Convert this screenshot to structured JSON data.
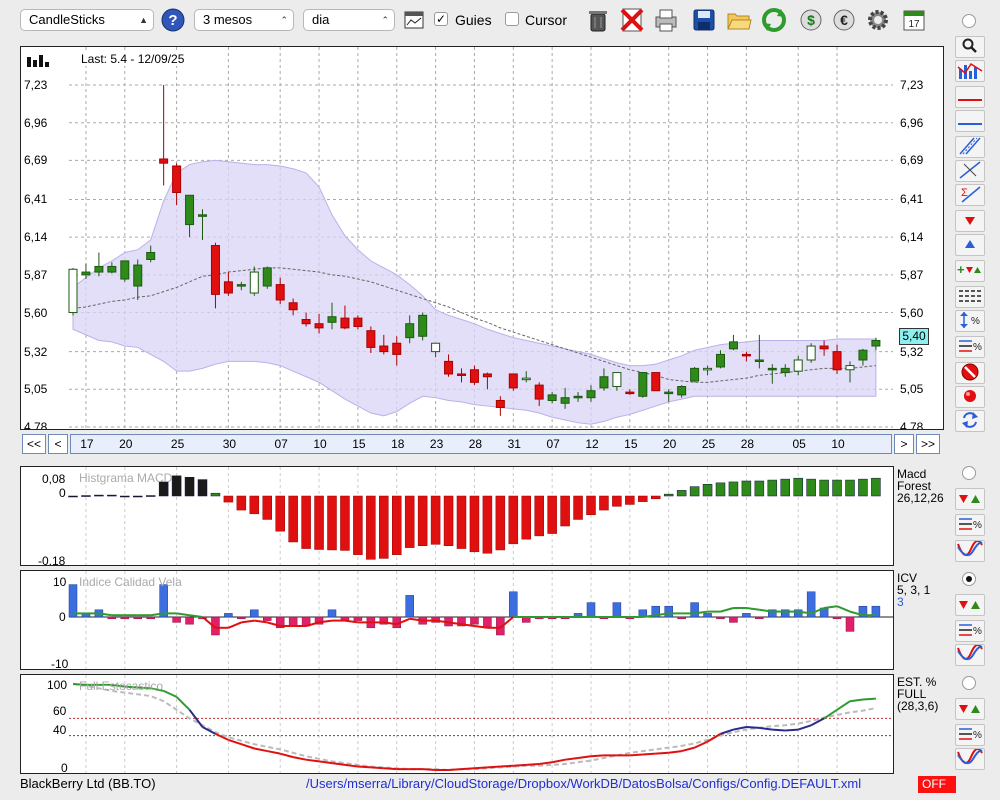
{
  "toolbar": {
    "chart_type": "CandleSticks",
    "period": "3 mesos",
    "interval": "dia",
    "guies_label": "Guies",
    "guies_checked": true,
    "cursor_label": "Cursor",
    "cursor_checked": false
  },
  "main_chart": {
    "last_label": "Last: 5.4 - 12/09/25",
    "price_tag": "5,40"
  },
  "nav": {
    "first": "<<",
    "prev": "<",
    "next": ">",
    "last": ">>"
  },
  "panels": {
    "macd": {
      "title": "Histgrama MACD",
      "name1": "Macd",
      "name2": "Forest",
      "params": "26,12,26",
      "y_labels": [
        "0,08",
        "0",
        "-0,18"
      ]
    },
    "icv": {
      "title": "Indice Calidad Vela",
      "name1": "ICV",
      "params": "5, 3, 1",
      "extra": "3",
      "y_labels": [
        "10",
        "0",
        "-10"
      ]
    },
    "est": {
      "title": "Full Estocastico",
      "name1": "EST. %",
      "name2": "FULL",
      "params": "(28,3,6)",
      "y_labels": [
        "100",
        "60",
        "40",
        "0"
      ]
    }
  },
  "status": {
    "company": "BlackBerry Ltd (BB.TO)",
    "path": "/Users/mserra/Library/CloudStorage/Dropbox/WorkDB/DatosBolsa/Configs/Config.DEFAULT.xml",
    "off": "OFF"
  },
  "colors": {
    "up": "#2e8b1a",
    "down": "#e01010",
    "band": "#d9d4f5",
    "ma": "#666666",
    "blue": "#2b5fd9"
  },
  "chart_data": [
    {
      "type": "candlestick",
      "title": "",
      "y_ticks": [
        7.23,
        6.96,
        6.69,
        6.41,
        6.14,
        5.87,
        5.6,
        5.32,
        5.05,
        4.78
      ],
      "ylim": [
        4.78,
        7.23
      ],
      "x_tick_labels": [
        "17",
        "20",
        "25",
        "30",
        "07",
        "10",
        "15",
        "18",
        "23",
        "28",
        "31",
        "07",
        "12",
        "15",
        "20",
        "25",
        "28",
        "05",
        "10"
      ],
      "grid": true,
      "candles": [
        {
          "o": 5.6,
          "h": 5.92,
          "l": 5.58,
          "c": 5.91
        },
        {
          "o": 5.87,
          "h": 5.95,
          "l": 5.84,
          "c": 5.89
        },
        {
          "o": 5.89,
          "h": 6.03,
          "l": 5.86,
          "c": 5.93
        },
        {
          "o": 5.89,
          "h": 5.96,
          "l": 5.88,
          "c": 5.93
        },
        {
          "o": 5.84,
          "h": 5.97,
          "l": 5.82,
          "c": 5.97
        },
        {
          "o": 5.79,
          "h": 5.98,
          "l": 5.69,
          "c": 5.94
        },
        {
          "o": 5.98,
          "h": 6.08,
          "l": 5.96,
          "c": 6.03
        },
        {
          "o": 6.7,
          "h": 7.23,
          "l": 6.51,
          "c": 6.67
        },
        {
          "o": 6.65,
          "h": 6.67,
          "l": 6.37,
          "c": 6.46
        },
        {
          "o": 6.23,
          "h": 6.44,
          "l": 6.14,
          "c": 6.44
        },
        {
          "o": 6.3,
          "h": 6.34,
          "l": 6.12,
          "c": 6.3
        },
        {
          "o": 6.08,
          "h": 6.1,
          "l": 5.63,
          "c": 5.73
        },
        {
          "o": 5.82,
          "h": 5.89,
          "l": 5.72,
          "c": 5.74
        },
        {
          "o": 5.8,
          "h": 5.82,
          "l": 5.76,
          "c": 5.8
        },
        {
          "o": 5.74,
          "h": 5.93,
          "l": 5.72,
          "c": 5.89
        },
        {
          "o": 5.79,
          "h": 5.93,
          "l": 5.77,
          "c": 5.92
        },
        {
          "o": 5.8,
          "h": 5.85,
          "l": 5.66,
          "c": 5.69
        },
        {
          "o": 5.67,
          "h": 5.7,
          "l": 5.58,
          "c": 5.62
        },
        {
          "o": 5.55,
          "h": 5.6,
          "l": 5.5,
          "c": 5.52
        },
        {
          "o": 5.52,
          "h": 5.59,
          "l": 5.45,
          "c": 5.49
        },
        {
          "o": 5.53,
          "h": 5.67,
          "l": 5.48,
          "c": 5.57
        },
        {
          "o": 5.56,
          "h": 5.65,
          "l": 5.48,
          "c": 5.49
        },
        {
          "o": 5.56,
          "h": 5.58,
          "l": 5.48,
          "c": 5.5
        },
        {
          "o": 5.47,
          "h": 5.5,
          "l": 5.31,
          "c": 5.35
        },
        {
          "o": 5.36,
          "h": 5.44,
          "l": 5.3,
          "c": 5.32
        },
        {
          "o": 5.38,
          "h": 5.43,
          "l": 5.22,
          "c": 5.3
        },
        {
          "o": 5.42,
          "h": 5.58,
          "l": 5.38,
          "c": 5.52
        },
        {
          "o": 5.43,
          "h": 5.6,
          "l": 5.4,
          "c": 5.58
        },
        {
          "o": 5.32,
          "h": 5.38,
          "l": 5.28,
          "c": 5.38
        },
        {
          "o": 5.25,
          "h": 5.3,
          "l": 5.14,
          "c": 5.16
        },
        {
          "o": 5.16,
          "h": 5.2,
          "l": 5.1,
          "c": 5.15
        },
        {
          "o": 5.19,
          "h": 5.22,
          "l": 5.08,
          "c": 5.1
        },
        {
          "o": 5.16,
          "h": 5.17,
          "l": 5.05,
          "c": 5.14
        },
        {
          "o": 4.97,
          "h": 5.0,
          "l": 4.86,
          "c": 4.92
        },
        {
          "o": 5.16,
          "h": 5.16,
          "l": 5.04,
          "c": 5.06
        },
        {
          "o": 5.12,
          "h": 5.18,
          "l": 5.1,
          "c": 5.13
        },
        {
          "o": 5.08,
          "h": 5.1,
          "l": 4.93,
          "c": 4.98
        },
        {
          "o": 4.97,
          "h": 5.03,
          "l": 4.95,
          "c": 5.01
        },
        {
          "o": 4.95,
          "h": 5.06,
          "l": 4.91,
          "c": 4.99
        },
        {
          "o": 4.99,
          "h": 5.03,
          "l": 4.96,
          "c": 5.0
        },
        {
          "o": 4.99,
          "h": 5.08,
          "l": 4.96,
          "c": 5.04
        },
        {
          "o": 5.06,
          "h": 5.2,
          "l": 5.04,
          "c": 5.14
        },
        {
          "o": 5.07,
          "h": 5.17,
          "l": 5.04,
          "c": 5.17
        },
        {
          "o": 5.03,
          "h": 5.05,
          "l": 5.01,
          "c": 5.02
        },
        {
          "o": 5.0,
          "h": 5.17,
          "l": 4.99,
          "c": 5.17
        },
        {
          "o": 5.17,
          "h": 5.17,
          "l": 5.04,
          "c": 5.04
        },
        {
          "o": 5.03,
          "h": 5.05,
          "l": 4.96,
          "c": 5.03
        },
        {
          "o": 5.01,
          "h": 5.08,
          "l": 4.99,
          "c": 5.07
        },
        {
          "o": 5.11,
          "h": 5.21,
          "l": 5.1,
          "c": 5.2
        },
        {
          "o": 5.19,
          "h": 5.22,
          "l": 5.15,
          "c": 5.2
        },
        {
          "o": 5.21,
          "h": 5.33,
          "l": 5.2,
          "c": 5.3
        },
        {
          "o": 5.34,
          "h": 5.44,
          "l": 5.33,
          "c": 5.39
        },
        {
          "o": 5.3,
          "h": 5.32,
          "l": 5.25,
          "c": 5.29
        },
        {
          "o": 5.26,
          "h": 5.44,
          "l": 5.2,
          "c": 5.26
        },
        {
          "o": 5.2,
          "h": 5.23,
          "l": 5.09,
          "c": 5.2
        },
        {
          "o": 5.17,
          "h": 5.23,
          "l": 5.14,
          "c": 5.2
        },
        {
          "o": 5.18,
          "h": 5.29,
          "l": 5.15,
          "c": 5.26
        },
        {
          "o": 5.26,
          "h": 5.38,
          "l": 5.24,
          "c": 5.36
        },
        {
          "o": 5.36,
          "h": 5.4,
          "l": 5.29,
          "c": 5.34
        },
        {
          "o": 5.32,
          "h": 5.37,
          "l": 5.16,
          "c": 5.19
        },
        {
          "o": 5.19,
          "h": 5.25,
          "l": 5.1,
          "c": 5.22
        },
        {
          "o": 5.26,
          "h": 5.34,
          "l": 5.22,
          "c": 5.33
        },
        {
          "o": 5.36,
          "h": 5.42,
          "l": 5.33,
          "c": 5.4
        }
      ],
      "ma": [
        5.63,
        5.64,
        5.66,
        5.68,
        5.69,
        5.71,
        5.72,
        5.75,
        5.78,
        5.82,
        5.86,
        5.87,
        5.89,
        5.9,
        5.91,
        5.92,
        5.92,
        5.91,
        5.9,
        5.89,
        5.87,
        5.86,
        5.84,
        5.82,
        5.79,
        5.76,
        5.73,
        5.7,
        5.67,
        5.64,
        5.6,
        5.56,
        5.53,
        5.49,
        5.46,
        5.43,
        5.4,
        5.37,
        5.34,
        5.31,
        5.28,
        5.25,
        5.22,
        5.19,
        5.17,
        5.15,
        5.12,
        5.11,
        5.1,
        5.1,
        5.11,
        5.12,
        5.13,
        5.15,
        5.16,
        5.17,
        5.18,
        5.19,
        5.2,
        5.2,
        5.2,
        5.21,
        5.22
      ],
      "band_upper": [
        5.78,
        5.85,
        5.92,
        5.97,
        6.03,
        6.05,
        6.12,
        6.4,
        6.6,
        6.66,
        6.68,
        6.69,
        6.68,
        6.67,
        6.66,
        6.66,
        6.65,
        6.63,
        6.6,
        6.5,
        6.3,
        6.15,
        6.05,
        5.97,
        5.92,
        5.87,
        5.8,
        5.72,
        5.62,
        5.58,
        5.55,
        5.52,
        5.48,
        5.45,
        5.42,
        5.4,
        5.38,
        5.36,
        5.34,
        5.32,
        5.3,
        5.27,
        5.24,
        5.22,
        5.22,
        5.23,
        5.26,
        5.29,
        5.33,
        5.35,
        5.37,
        5.38,
        5.39,
        5.4,
        5.4,
        5.4,
        5.4,
        5.4,
        5.4,
        5.41,
        5.41,
        5.41,
        5.41
      ],
      "band_lower": [
        5.48,
        5.44,
        5.4,
        5.39,
        5.36,
        5.35,
        5.3,
        5.25,
        5.18,
        5.18,
        5.2,
        5.23,
        5.25,
        5.25,
        5.25,
        5.24,
        5.22,
        5.18,
        5.14,
        5.1,
        5.04,
        4.98,
        4.93,
        4.88,
        4.86,
        4.89,
        4.95,
        5.0,
        4.99,
        4.97,
        4.96,
        4.94,
        4.93,
        4.92,
        4.91,
        4.9,
        4.88,
        4.85,
        4.83,
        4.81,
        4.8,
        4.82,
        4.85,
        4.87,
        4.9,
        4.93,
        4.96,
        4.98,
        5.0,
        5.0,
        5.0,
        5.0,
        5.0,
        5.0,
        5.0,
        5.0,
        5.0,
        5.0,
        5.0,
        5.0,
        5.0,
        5.0,
        5.0
      ]
    },
    {
      "type": "bar",
      "title": "Histgrama MACD",
      "ylim": [
        -0.18,
        0.08
      ],
      "values": [
        0,
        0.001,
        0.002,
        0.002,
        0,
        0,
        0.001,
        0.03,
        0.043,
        0.04,
        0.035,
        0.006,
        -0.013,
        -0.03,
        -0.038,
        -0.05,
        -0.075,
        -0.098,
        -0.112,
        -0.114,
        -0.115,
        -0.116,
        -0.125,
        -0.135,
        -0.133,
        -0.125,
        -0.11,
        -0.106,
        -0.103,
        -0.106,
        -0.112,
        -0.119,
        -0.122,
        -0.115,
        -0.102,
        -0.092,
        -0.085,
        -0.08,
        -0.064,
        -0.05,
        -0.04,
        -0.03,
        -0.022,
        -0.018,
        -0.012,
        -0.006,
        0.004,
        0.012,
        0.02,
        0.025,
        0.028,
        0.03,
        0.032,
        0.032,
        0.034,
        0.036,
        0.038,
        0.036,
        0.034,
        0.034,
        0.034,
        0.036,
        0.038
      ]
    },
    {
      "type": "bar",
      "title": "Indice Calidad Vela",
      "ylim": [
        -10,
        10
      ],
      "values": [
        9,
        1,
        2,
        -0.5,
        -0.5,
        -0.5,
        -0.5,
        9,
        -1.5,
        -2,
        -0.5,
        -5,
        1,
        -0.5,
        2,
        -1,
        -3,
        -2.5,
        -2.5,
        -2,
        2,
        -1,
        -1,
        -3,
        -2,
        -3,
        6,
        -2,
        -1.5,
        -2.5,
        -2.5,
        -2,
        -3,
        -5,
        7,
        -1.5,
        -0.5,
        -0.5,
        -0.5,
        1,
        4,
        -0.5,
        4,
        -0.5,
        2,
        3,
        3,
        -0.5,
        4,
        1,
        -0.5,
        -1.5,
        1,
        -0.5,
        2,
        2,
        2,
        7,
        2.5,
        -0.5,
        -4,
        3,
        3
      ],
      "line": [
        1,
        1,
        1,
        0.5,
        0.5,
        0.5,
        0.5,
        1,
        1,
        0.5,
        0,
        -3,
        -3,
        -1.5,
        -1,
        -1.5,
        -2.5,
        -2.5,
        -2.5,
        -1.5,
        -1,
        -1,
        -1.5,
        -1.5,
        -1.5,
        -2,
        -0.5,
        -1,
        -1,
        -1.5,
        -2,
        -2.5,
        -3,
        -3,
        0,
        0,
        0,
        0,
        0,
        0,
        0,
        0,
        0,
        0,
        0,
        0.5,
        1,
        1,
        1,
        1.5,
        1.5,
        2.5,
        2.5,
        2,
        1.5,
        1.5,
        1.5,
        1,
        2.5,
        3,
        1.5,
        0.5,
        0.5
      ]
    },
    {
      "type": "line",
      "title": "Full Estocastico",
      "ylim": [
        0,
        100
      ],
      "series": [
        {
          "values": [
            100,
            99,
            99,
            99,
            97,
            96,
            95,
            92,
            85,
            70,
            50,
            42,
            35,
            30,
            25,
            22,
            19,
            15,
            12,
            10,
            8,
            6,
            4,
            3,
            2,
            1,
            1,
            1,
            0,
            0,
            1,
            2,
            3,
            4,
            5,
            6,
            7,
            9,
            12,
            14,
            16,
            17,
            17,
            17,
            18,
            19,
            20,
            22,
            26,
            33,
            42,
            47,
            50,
            49,
            47,
            46,
            47,
            52,
            60,
            70,
            80,
            82,
            83
          ]
        },
        {
          "values": [
            100,
            98,
            95,
            92,
            90,
            88,
            86,
            80,
            70,
            60,
            52,
            44,
            38,
            34,
            30,
            27,
            24,
            20,
            16,
            13,
            10,
            8,
            6,
            4,
            3,
            2,
            1,
            1,
            1,
            0,
            1,
            1,
            2,
            3,
            4,
            5,
            5,
            6,
            7,
            9,
            11,
            14,
            17,
            20,
            22,
            24,
            26,
            28,
            31,
            35,
            40,
            44,
            47,
            49,
            51,
            52,
            54,
            57,
            61,
            64,
            67,
            69,
            72
          ]
        }
      ]
    }
  ]
}
